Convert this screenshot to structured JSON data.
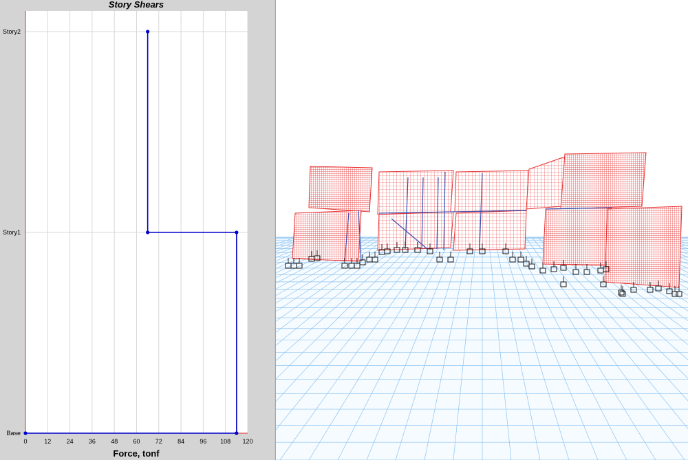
{
  "window": {
    "left_pane": "story-shears-plot",
    "right_pane": "3d-deformed-model-view"
  },
  "chart_data": {
    "type": "line",
    "title": "Story Shears",
    "xlabel": "Force, tonf",
    "ylabel": "",
    "xlim": [
      0,
      120
    ],
    "x_ticks": [
      0,
      12,
      24,
      36,
      48,
      60,
      72,
      84,
      96,
      108,
      120
    ],
    "y_categories": [
      "Base",
      "Story1",
      "Story2"
    ],
    "grid": true,
    "series": [
      {
        "color": "#0000cc",
        "points": [
          {
            "x": 0,
            "y": "Base"
          },
          {
            "x": 114,
            "y": "Base"
          },
          {
            "x": 114,
            "y": "Story1"
          },
          {
            "x": 66,
            "y": "Story1"
          },
          {
            "x": 66,
            "y": "Story2"
          }
        ]
      }
    ],
    "colors": {
      "line": "#0000cc",
      "axis_left": "#e03030",
      "grid": "#d8d8d8",
      "plot_bg": "#ffffff"
    }
  },
  "view3d": {
    "colors": {
      "mesh": "#e83030",
      "frame": "#3a4fb0",
      "ground_grid": "#8cc3f0",
      "supports": "#000000"
    }
  }
}
